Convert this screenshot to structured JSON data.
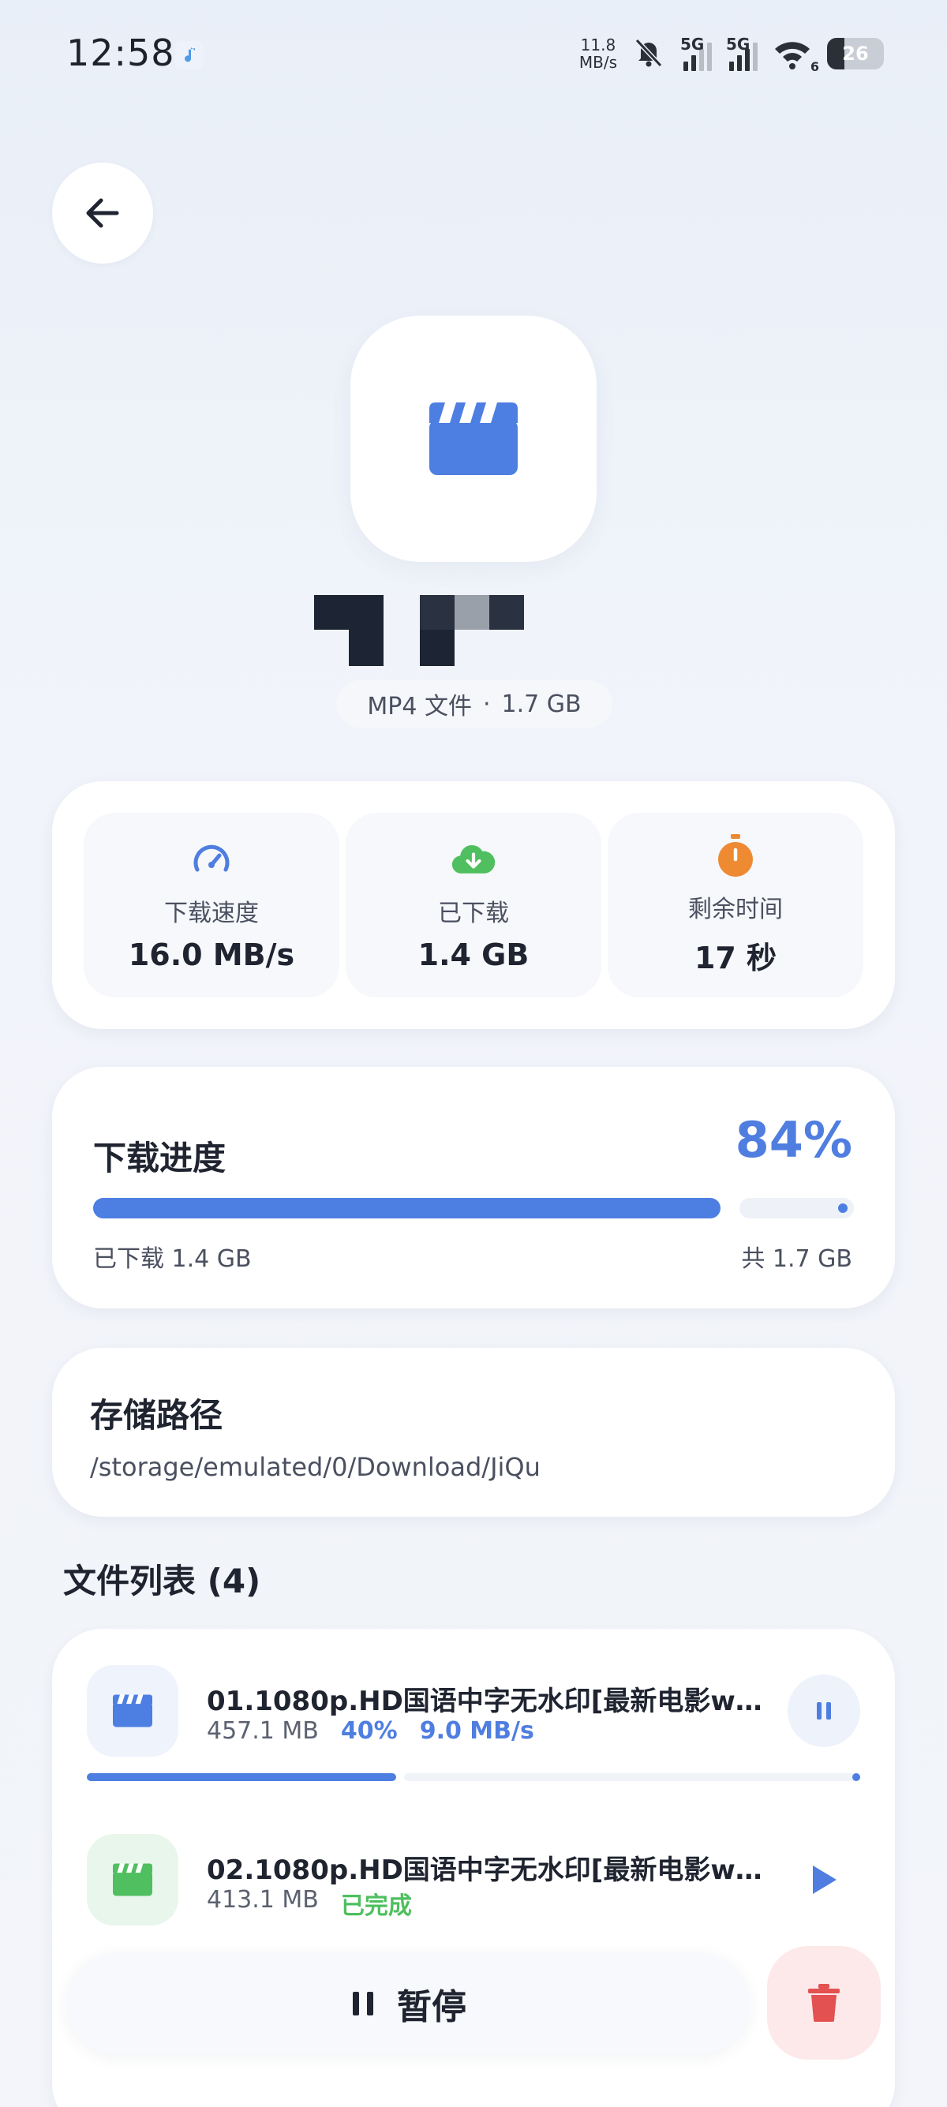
{
  "status_bar": {
    "time": "12:58",
    "net_speed_value": "11.8",
    "net_speed_unit": "MB/s",
    "signal_1_label": "5G",
    "signal_2_label": "5G",
    "wifi_badge": "6",
    "battery_level": "26"
  },
  "hero": {
    "file_type": "MP4 文件",
    "separator": "·",
    "file_size": "1.7 GB"
  },
  "stats": [
    {
      "label": "下载速度",
      "value": "16.0 MB/s",
      "icon": "speedometer-icon",
      "color": "#4f7ee0"
    },
    {
      "label": "已下载",
      "value": "1.4 GB",
      "icon": "cloud-download-icon",
      "color": "#4fbf5f"
    },
    {
      "label": "剩余时间",
      "value": "17 秒",
      "icon": "stopwatch-icon",
      "color": "#ee8a32"
    }
  ],
  "progress": {
    "title": "下载进度",
    "percent_label": "84%",
    "percent": 84,
    "downloaded_label": "已下载 1.4 GB",
    "total_label": "共 1.7 GB"
  },
  "storage": {
    "title": "存储路径",
    "path": "/storage/emulated/0/Download/JiQu"
  },
  "file_list": {
    "heading": "文件列表 (4)",
    "files": [
      {
        "name": "01.1080p.HD国语中字无水印[最新电影ww...",
        "size": "457.1 MB",
        "percent_label": "40%",
        "percent": 40,
        "speed": "9.0 MB/s",
        "status": "",
        "action_icon": "pause-icon"
      },
      {
        "name": "02.1080p.HD国语中字无水印[最新电影ww...",
        "size": "413.1 MB",
        "percent_label": "",
        "speed": "",
        "status": "已完成",
        "action_icon": "play-icon"
      }
    ]
  },
  "bottom": {
    "pause_label": "暂停"
  },
  "colors": {
    "accent_blue": "#4f7ee0",
    "success_green": "#4fbf5f",
    "warning_orange": "#ee8a32",
    "danger_red": "#e35150"
  }
}
